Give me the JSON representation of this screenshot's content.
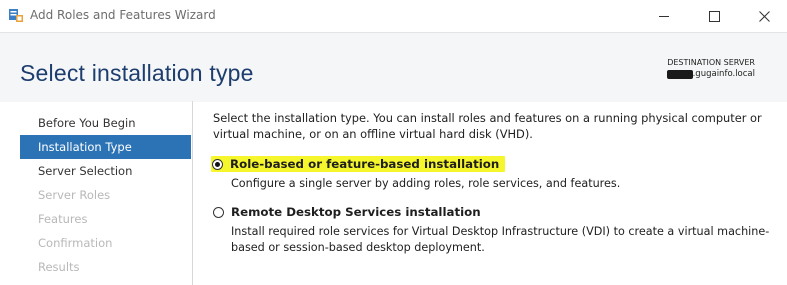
{
  "window": {
    "title": "Add Roles and Features Wizard",
    "icon": "server-manager-icon",
    "controls": [
      "minimize-icon",
      "maximize-icon",
      "close-icon"
    ]
  },
  "header": {
    "page_title": "Select installation type",
    "destination_label": "DESTINATION SERVER",
    "destination_server": ".gugainfo.local"
  },
  "nav": {
    "items": [
      {
        "label": "Before You Begin",
        "state": "normal"
      },
      {
        "label": "Installation Type",
        "state": "active"
      },
      {
        "label": "Server Selection",
        "state": "normal"
      },
      {
        "label": "Server Roles",
        "state": "disabled"
      },
      {
        "label": "Features",
        "state": "disabled"
      },
      {
        "label": "Confirmation",
        "state": "disabled"
      },
      {
        "label": "Results",
        "state": "disabled"
      }
    ]
  },
  "main": {
    "intro": "Select the installation type. You can install roles and features on a running physical computer or virtual machine, or on an offline virtual hard disk (VHD).",
    "options": [
      {
        "label": "Role-based or feature-based installation",
        "description": "Configure a single server by adding roles, role services, and features.",
        "selected": true,
        "highlighted": true
      },
      {
        "label": "Remote Desktop Services installation",
        "description": "Install required role services for Virtual Desktop Infrastructure (VDI) to create a virtual machine-based or session-based desktop deployment.",
        "selected": false,
        "highlighted": false
      }
    ]
  },
  "colors": {
    "accent": "#2c73b6",
    "title": "#1c3d6e",
    "highlight": "#f6f62d",
    "header_bg": "#f5f6f7"
  }
}
